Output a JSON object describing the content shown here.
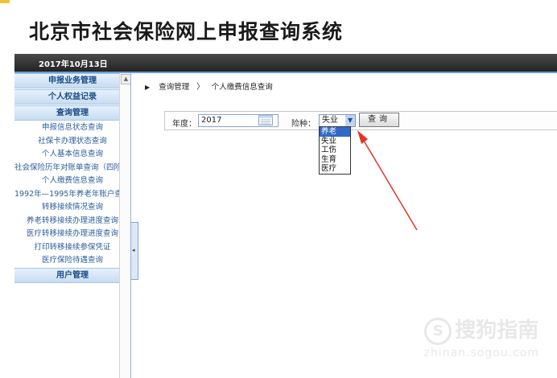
{
  "header": {
    "title": "北京市社会保险网上申报查询系统",
    "date": "2017年10月13日"
  },
  "sidebar": {
    "sections": [
      {
        "label": "申报业务管理"
      },
      {
        "label": "个人权益记录"
      },
      {
        "label": "查询管理"
      }
    ],
    "items": [
      {
        "label": "申报信息状态查询"
      },
      {
        "label": "社保卡办理状态查询"
      },
      {
        "label": "个人基本信息查询"
      },
      {
        "label": "社会保险历年对账单查询（四险"
      },
      {
        "label": "个人缴费信息查询"
      },
      {
        "label": "1992年—1995年养老年账户查"
      },
      {
        "label": "转移接续情况查询"
      },
      {
        "label": "养老转移接续办理进度查询"
      },
      {
        "label": "医疗转移接续办理进度查询"
      },
      {
        "label": "打印转移接续参保凭证"
      },
      {
        "label": "医疗保险待遇查询"
      }
    ],
    "footer_section": {
      "label": "用户管理"
    }
  },
  "breadcrumb": {
    "parent": "查询管理",
    "separator": "〉",
    "current": "个人缴费信息查询"
  },
  "form": {
    "year_label": "年度：",
    "year_value": "2017",
    "insurance_label": "险种：",
    "insurance_selected": "失业",
    "query_button": "查询",
    "options": [
      "养老",
      "失业",
      "工伤",
      "生育",
      "医疗"
    ],
    "highlighted_option": "养老"
  },
  "watermark": {
    "brand": "搜狗指南",
    "url": "zhinan.sogou.com"
  },
  "colors": {
    "accent": "#1b4a87",
    "link": "#2c5d9a",
    "arrow": "#e5332a",
    "selection": "#3169c6"
  }
}
